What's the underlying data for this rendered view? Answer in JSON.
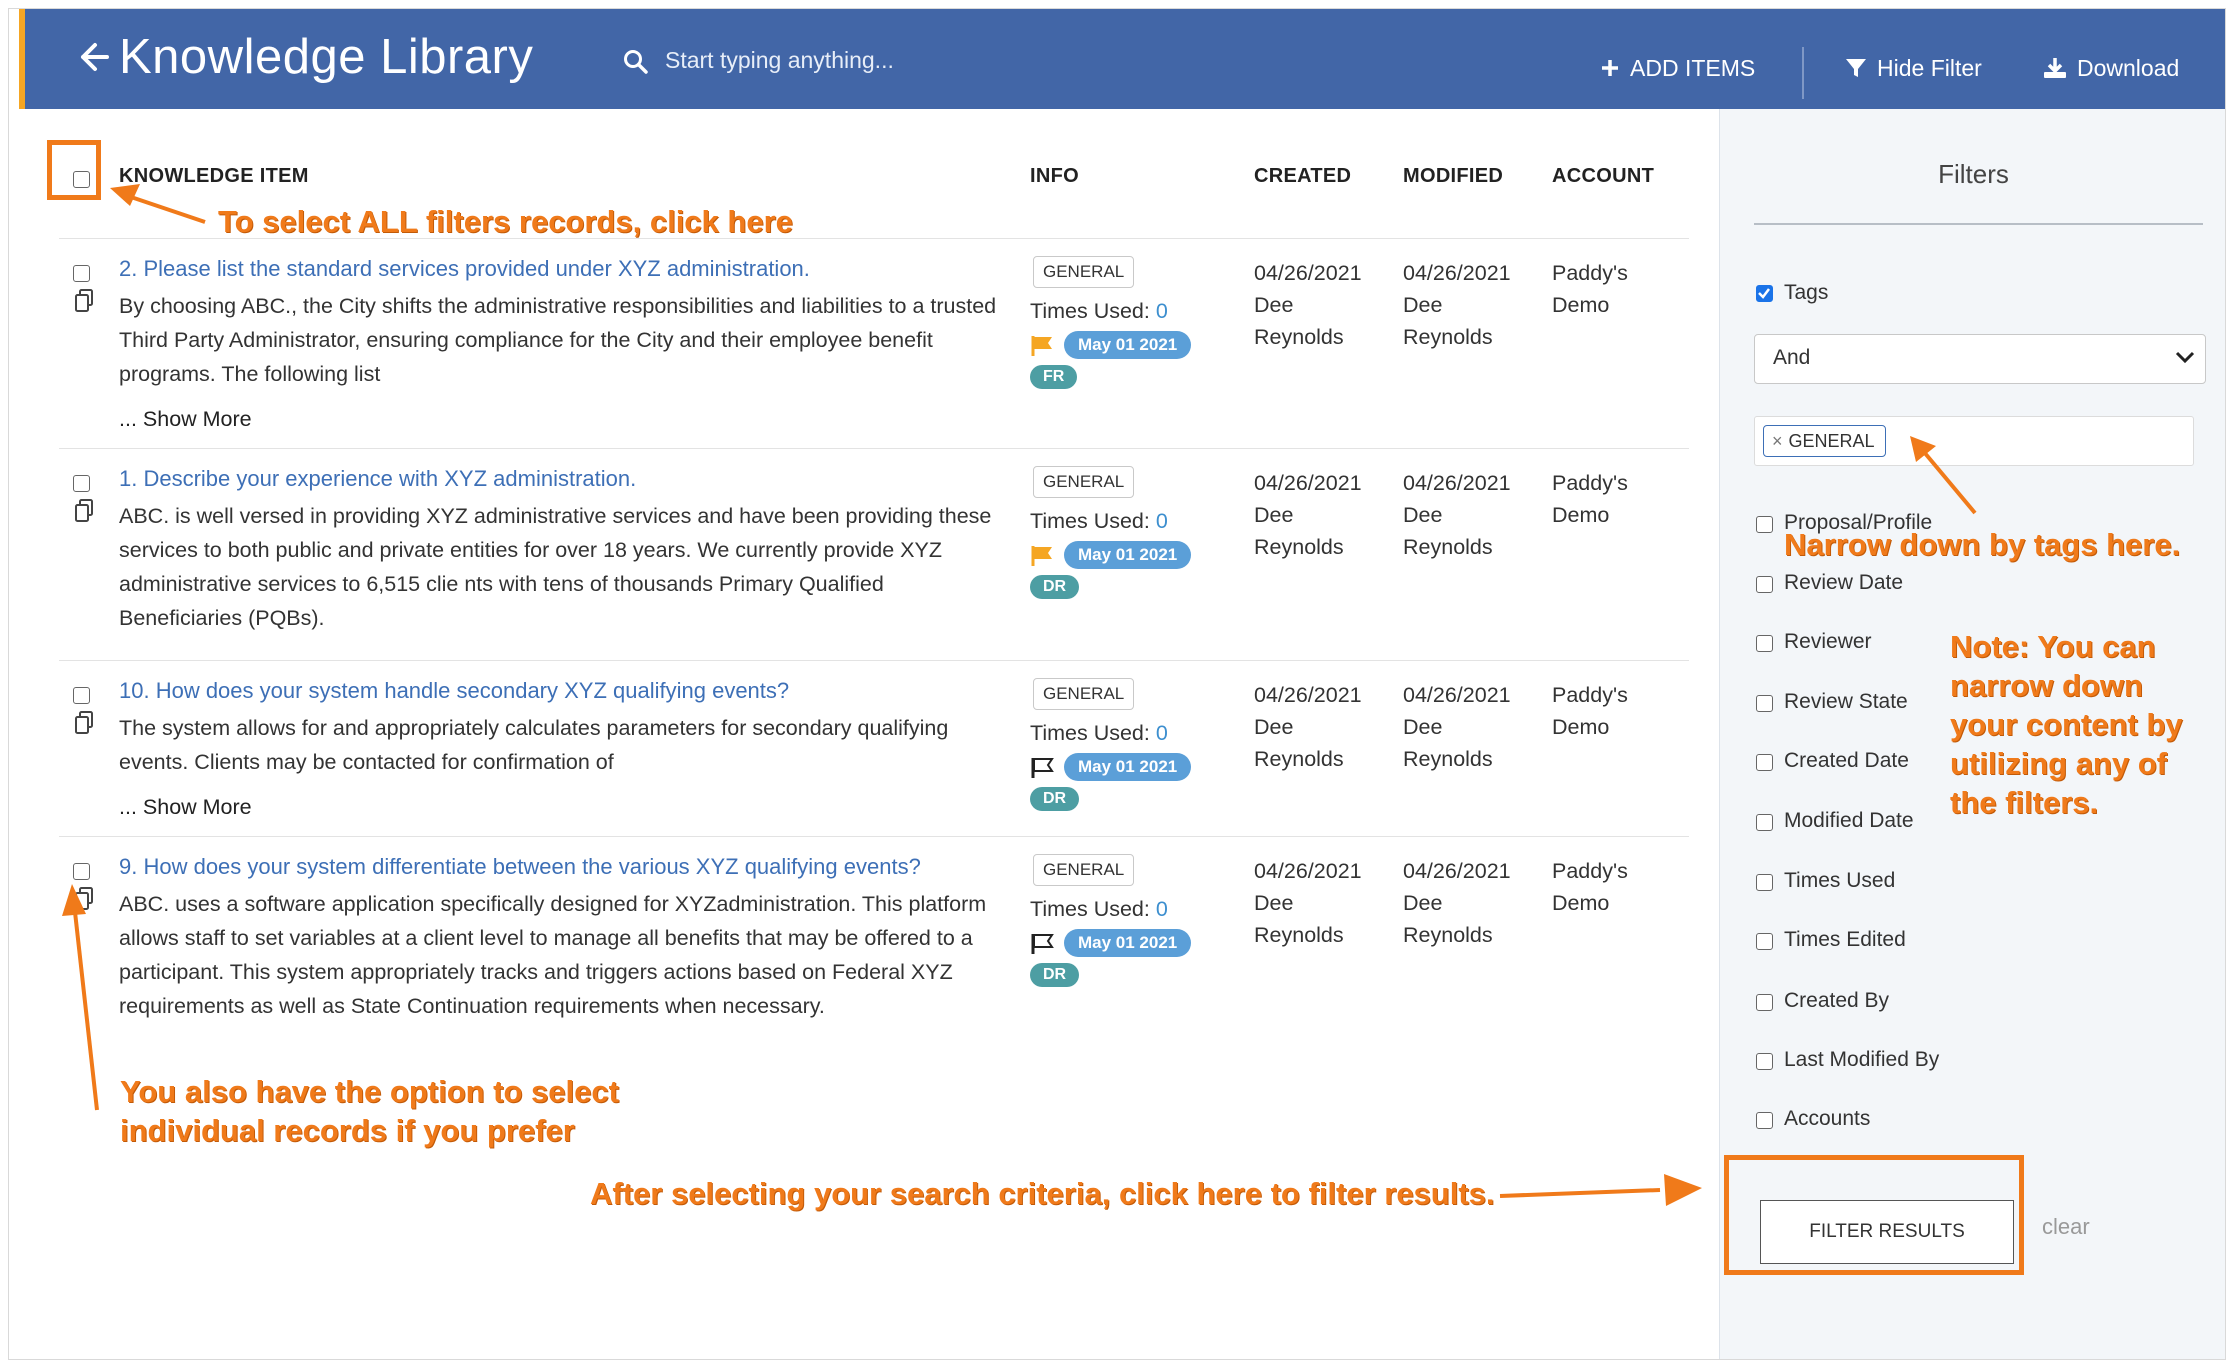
{
  "header": {
    "title": "Knowledge Library",
    "search_placeholder": "Start typing anything...",
    "add_items_label": "ADD ITEMS",
    "hide_filter_label": "Hide Filter",
    "download_label": "Download"
  },
  "table": {
    "columns": [
      "KNOWLEDGE ITEM",
      "INFO",
      "CREATED",
      "MODIFIED",
      "ACCOUNT"
    ],
    "rows": [
      {
        "title": "2. Please list the standard services provided under XYZ administration.",
        "body": "By choosing ABC., the City shifts the administrative responsibilities and liabilities to a trusted Third Party Administrator, ensuring compliance for the City and their employee benefit programs. The following list",
        "show_more": "... Show More",
        "tag": "GENERAL",
        "times_used_label": "Times Used:",
        "times_used": "0",
        "date_pill": "May 01 2021",
        "lang": "FR",
        "created_date": "04/26/2021",
        "created_by": "Dee\nReynolds",
        "modified_date": "04/26/2021",
        "modified_by": "Dee\nReynolds",
        "account": "Paddy's\nDemo"
      },
      {
        "title": "1. Describe your experience with XYZ administration.",
        "body": "ABC. is well versed in providing XYZ administrative services and have been providing these services to both public and private entities for over 18 years. We currently provide XYZ administrative services to 6,515 clie nts with tens of thousands Primary Qualified Beneficiaries (PQBs).",
        "show_more": "",
        "tag": "GENERAL",
        "times_used_label": "Times Used:",
        "times_used": "0",
        "date_pill": "May 01 2021",
        "lang": "DR",
        "created_date": "04/26/2021",
        "created_by": "Dee\nReynolds",
        "modified_date": "04/26/2021",
        "modified_by": "Dee\nReynolds",
        "account": "Paddy's\nDemo"
      },
      {
        "title": "10. How does your system handle secondary XYZ qualifying events?",
        "body": "The system allows for and appropriately calculates parameters for secondary qualifying events. Clients may be contacted for confirmation of",
        "show_more": "... Show More",
        "tag": "GENERAL",
        "times_used_label": "Times Used:",
        "times_used": "0",
        "date_pill": "May 01 2021",
        "lang": "DR",
        "created_date": "04/26/2021",
        "created_by": "Dee\nReynolds",
        "modified_date": "04/26/2021",
        "modified_by": "Dee\nReynolds",
        "account": "Paddy's\nDemo"
      },
      {
        "title": "9. How does your system differentiate between the various XYZ qualifying events?",
        "body": "ABC. uses a software application specifically designed for XYZadministration. This platform allows staff to set variables at a client level to manage all benefits that may be offered to a participant. This system appropriately tracks and triggers actions based on Federal XYZ requirements as well as State Continuation requirements when necessary.",
        "show_more": "",
        "tag": "GENERAL",
        "times_used_label": "Times Used:",
        "times_used": "0",
        "date_pill": "May 01 2021",
        "lang": "DR",
        "created_date": "04/26/2021",
        "created_by": "Dee\nReynolds",
        "modified_date": "04/26/2021",
        "modified_by": "Dee\nReynolds",
        "account": "Paddy's\nDemo"
      }
    ]
  },
  "filters": {
    "title": "Filters",
    "tags_label": "Tags",
    "logic_value": "And",
    "selected_tag": "GENERAL",
    "options": [
      "Proposal/Profile",
      "Review Date",
      "Reviewer",
      "Review State",
      "Created Date",
      "Modified Date",
      "Times Used",
      "Times Edited",
      "Created By",
      "Last Modified By",
      "Accounts"
    ],
    "filter_button": "FILTER RESULTS",
    "clear_label": "clear"
  },
  "annotations": {
    "select_all": "To select ALL filters records, click here",
    "tags": "Narrow down by tags here.",
    "note_lines": [
      "Note: You can",
      "narrow down",
      "your content by",
      "utilizing any of",
      "the filters."
    ],
    "individual_lines": [
      "You also have the option to select",
      "individual records if you prefer"
    ],
    "filter_results": "After selecting your search criteria, click here to filter results."
  },
  "colors": {
    "header_bg": "#4266a7",
    "accent_orange": "#f07a1a",
    "link_blue": "#3d6fb6",
    "date_pill": "#5b9fd8",
    "lang_pill": "#4d9ea3",
    "flag_yellow": "#f5a623"
  }
}
